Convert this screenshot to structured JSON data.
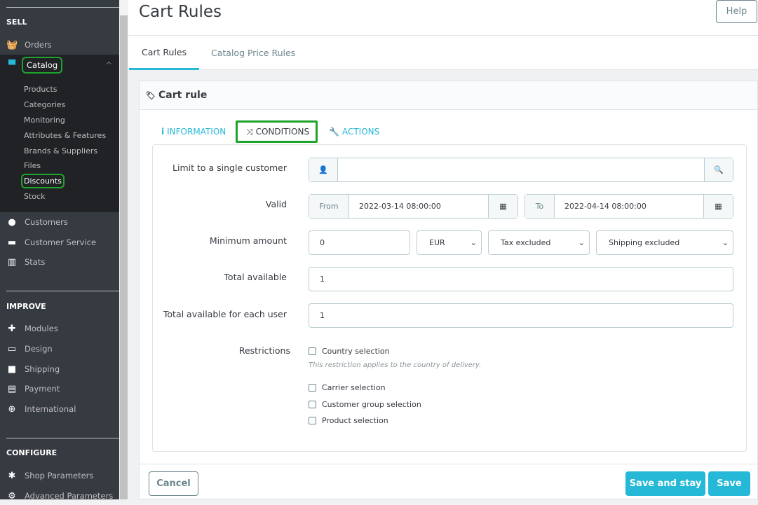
{
  "sidebar": {
    "sections": {
      "sell": "SELL",
      "improve": "IMPROVE",
      "configure": "CONFIGURE"
    },
    "orders": "Orders",
    "catalog": "Catalog",
    "catalog_items": [
      "Products",
      "Categories",
      "Monitoring",
      "Attributes & Features",
      "Brands & Suppliers",
      "Files",
      "Discounts",
      "Stock"
    ],
    "customers": "Customers",
    "customer_service": "Customer Service",
    "stats": "Stats",
    "improve_items": [
      "Modules",
      "Design",
      "Shipping",
      "Payment",
      "International"
    ],
    "configure_items": [
      "Shop Parameters",
      "Advanced Parameters"
    ]
  },
  "header": {
    "title": "Cart Rules",
    "help": "Help",
    "tabs": [
      "Cart Rules",
      "Catalog Price Rules"
    ]
  },
  "panel": {
    "title": "Cart rule",
    "tabs": [
      "INFORMATION",
      "CONDITIONS",
      "ACTIONS"
    ]
  },
  "form": {
    "customer_label": "Limit to a single customer",
    "customer_value": "",
    "valid_label": "Valid",
    "from_label": "From",
    "from_value": "2022-03-14 08:00:00",
    "to_label": "To",
    "to_value": "2022-04-14 08:00:00",
    "min_label": "Minimum amount",
    "min_value": "0",
    "currency": "EUR",
    "tax": "Tax excluded",
    "shipping": "Shipping excluded",
    "total_label": "Total available",
    "total_value": "1",
    "per_user_label": "Total available for each user",
    "per_user_value": "1",
    "restrictions_label": "Restrictions",
    "restrictions": [
      "Country selection",
      "Carrier selection",
      "Customer group selection",
      "Product selection"
    ],
    "country_hint": "This restriction applies to the country of delivery."
  },
  "footer": {
    "cancel": "Cancel",
    "save_stay": "Save and stay",
    "save": "Save"
  },
  "colors": {
    "accent": "#25b9d7",
    "highlight": "#1ea42a",
    "sidebar": "#363a41"
  }
}
